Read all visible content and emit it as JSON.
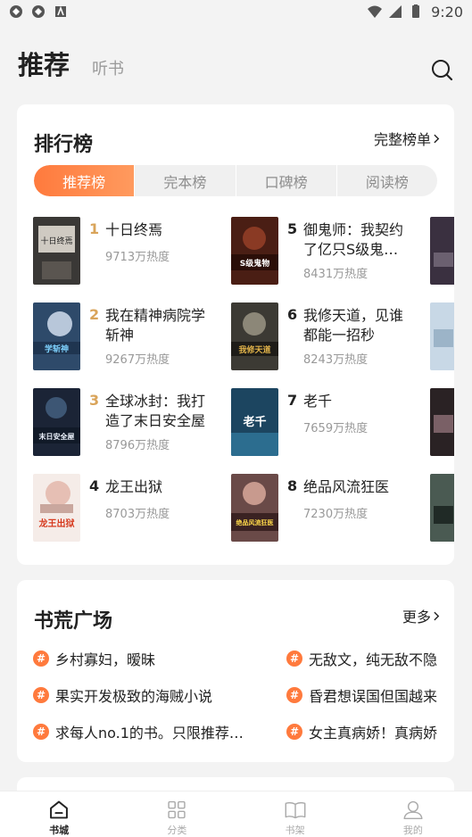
{
  "status_bar": {
    "time": "9:20"
  },
  "header": {
    "title": "推荐",
    "subtitle": "听书"
  },
  "ranking": {
    "title": "排行榜",
    "more": "完整榜单",
    "tabs": [
      "推荐榜",
      "完本榜",
      "口碑榜",
      "阅读榜"
    ],
    "active_tab": 0,
    "books": [
      {
        "rank": "1",
        "title": "十日终焉",
        "heat": "9713万热度",
        "cover_text": "十日终焉"
      },
      {
        "rank": "2",
        "title": "我在精神病院学斩神",
        "heat": "9267万热度",
        "cover_text": "学斩神"
      },
      {
        "rank": "3",
        "title": "全球冰封：我打造了末日安全屋",
        "heat": "8796万热度",
        "cover_text": "末日安全屋"
      },
      {
        "rank": "4",
        "title": "龙王出狱",
        "heat": "8703万热度",
        "cover_text": "龙王出狱"
      },
      {
        "rank": "5",
        "title": "御鬼师：我契约了亿只S级鬼…",
        "heat": "8431万热度",
        "cover_text": "S级鬼物"
      },
      {
        "rank": "6",
        "title": "我修天道，见谁都能一招秒",
        "heat": "8243万热度",
        "cover_text": "我修天道"
      },
      {
        "rank": "7",
        "title": "老千",
        "heat": "7659万热度",
        "cover_text": "老千"
      },
      {
        "rank": "8",
        "title": "绝品风流狂医",
        "heat": "7230万热度",
        "cover_text": "绝品风流狂医"
      }
    ],
    "rank_colors": {
      "top3": "#d9a45a",
      "normal": "#222222"
    }
  },
  "square": {
    "title": "书荒广场",
    "more": "更多",
    "topics": [
      "乡村寡妇，暧昧",
      "无敌文，纯无敌不隐",
      "果实开发极致的海贼小说",
      "昏君想误国但国越来",
      "求每人no.1的书。只限推荐…",
      "女主真病娇！真病娇"
    ]
  },
  "bottom_nav": [
    {
      "label": "书城",
      "icon": "home-icon",
      "active": true
    },
    {
      "label": "分类",
      "icon": "grid-icon",
      "active": false
    },
    {
      "label": "书架",
      "icon": "book-icon",
      "active": false
    },
    {
      "label": "我的",
      "icon": "user-icon",
      "active": false
    }
  ],
  "colors": {
    "accent": "#ff7a3d",
    "background": "#f3f3f3"
  }
}
